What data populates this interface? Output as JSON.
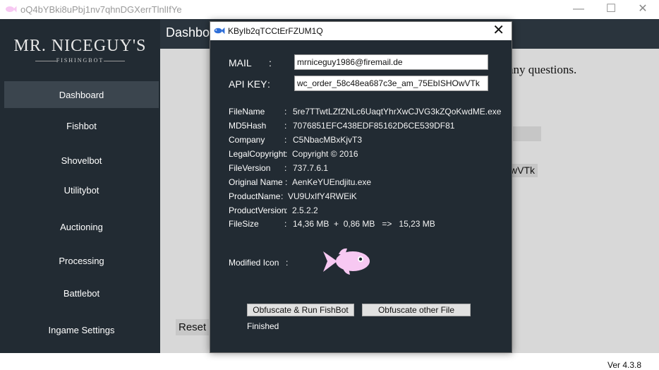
{
  "window": {
    "title": "oQ4bYBki8uPbj1nv7qhnDGXerrTlnlIfYe",
    "minimize_glyph": "—",
    "maximize_glyph": "☐",
    "close_glyph": "✕"
  },
  "sidebar": {
    "logo_main": "MR. NICEGUY'S",
    "logo_sub": "FISHINGBOT",
    "items": [
      {
        "label": "Dashboard"
      },
      {
        "label": "Fishbot"
      },
      {
        "label": "Shovelbot"
      },
      {
        "label": "Utilitybot"
      },
      {
        "label": "Auctioning"
      },
      {
        "label": "Processing"
      },
      {
        "label": "Battlebot"
      },
      {
        "label": "Ingame Settings"
      }
    ]
  },
  "content": {
    "heading": "Dashbo",
    "partial_text": "any questions.",
    "key_tail": "wVTk",
    "reset_label": "Reset",
    "version": "Ver 4.3.8"
  },
  "dialog": {
    "title": "KByIb2qTCCtErFZUM1Q",
    "close_glyph": "✕",
    "mail_label": "MAIL",
    "mail_colon": ":",
    "mail_value": "mrniceguy1986@firemail.de",
    "apikey_label": "API KEY",
    "apikey_colon": ":",
    "apikey_value": "wc_order_58c48ea687c3e_am_75EbISHOwVTk",
    "info": [
      {
        "key": "FileName",
        "value": "5re7TTwtLZfZNLc6UaqtYhrXwCJVG3kZQoKwdME.exe"
      },
      {
        "key": "MD5Hash",
        "value": "7076851EFC438EDF85162D6CE539DF81"
      },
      {
        "key": "Company",
        "value": "C5NbacMBxKjvT3"
      },
      {
        "key": "LegalCopyright",
        "value": "Copyright © 2016"
      },
      {
        "key": "FileVersion",
        "value": "737.7.6.1"
      },
      {
        "key": "Original Name",
        "value": "AenKeYUEndjitu.exe"
      },
      {
        "key": "ProductName",
        "value": "VU9UxIfY4RWEiK"
      },
      {
        "key": "ProductVersion",
        "value": "2.5.2.2"
      },
      {
        "key": "FileSize",
        "value": "14,36 MB  +  0,86 MB   =>   15,23 MB"
      }
    ],
    "info_sep": ":",
    "modified_icon_label": "Modified Icon",
    "modified_icon_colon": ":",
    "run_button": "Obfuscate & Run FishBot",
    "other_button": "Obfuscate other File",
    "status": "Finished"
  },
  "colors": {
    "sidebar_bg": "#222b33",
    "content_bg": "#d8d8d8",
    "fish_pink": "#f7c8f2"
  },
  "icons": {
    "app_icon": "fish-icon",
    "dialog_icon": "fish-icon",
    "modified_icon": "fish-icon"
  }
}
